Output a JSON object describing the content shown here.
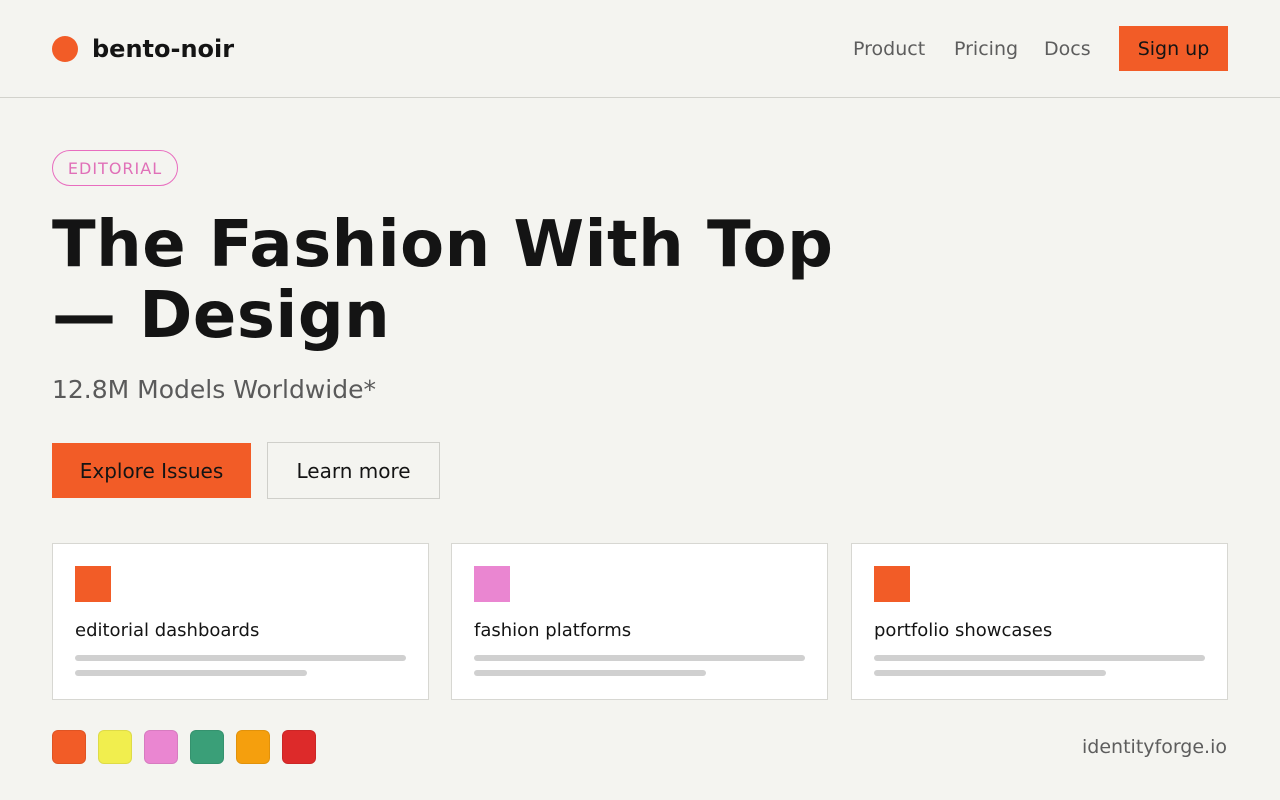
{
  "header": {
    "brand": "bento-noir",
    "nav": [
      "Product",
      "Pricing",
      "Docs"
    ],
    "signup_label": "Sign up"
  },
  "hero": {
    "tag": "EDITORIAL",
    "title": "The Fashion With Top — Design",
    "subtitle": "12.8M Models Worldwide*",
    "primary_cta": "Explore Issues",
    "secondary_cta": "Learn more"
  },
  "cards": [
    {
      "label": "editorial dashboards",
      "color": "#f25c27"
    },
    {
      "label": "fashion platforms",
      "color": "#ea86d1"
    },
    {
      "label": "portfolio showcases",
      "color": "#f25c27"
    }
  ],
  "palette": [
    "#f25c27",
    "#f1ee4e",
    "#ea86d1",
    "#3a9f78",
    "#f59f0d",
    "#dd2a2a"
  ],
  "footer": {
    "domain": "identityforge.io"
  },
  "colors": {
    "accent": "#f25c27",
    "pink": "#ea86d1",
    "background": "#f4f4f0"
  }
}
